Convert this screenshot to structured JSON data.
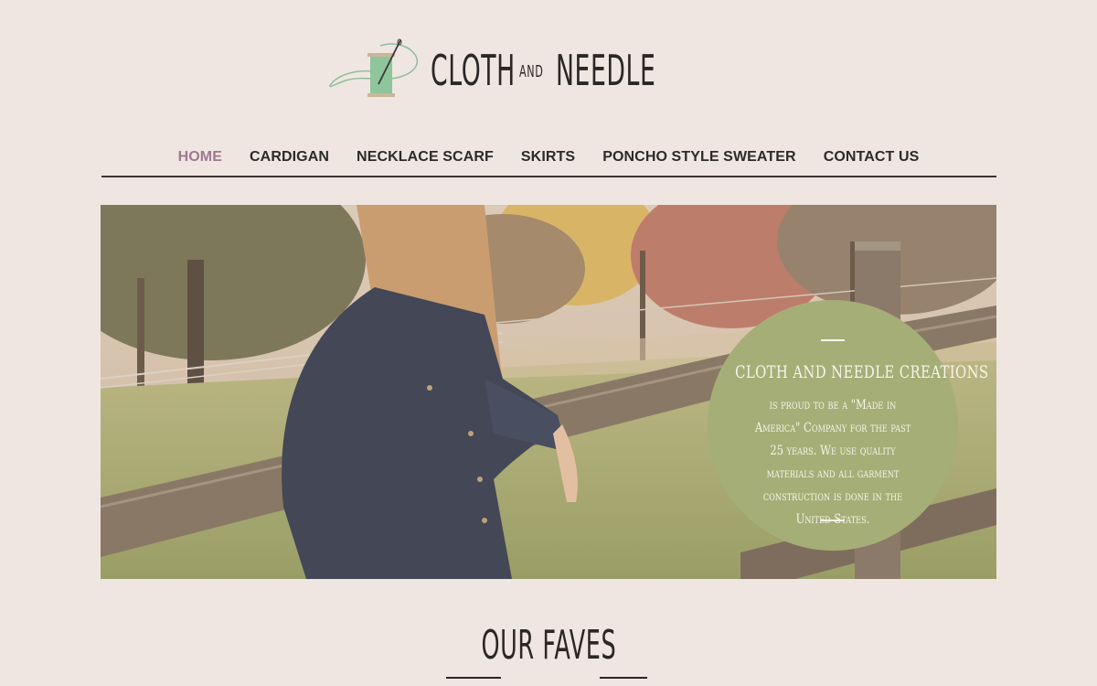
{
  "brand": {
    "word1": "CLOTH",
    "word2": "AND",
    "word3": "NEEDLE",
    "accent": "#a0788e",
    "spool_color": "#8fc59a"
  },
  "nav": {
    "items": [
      {
        "label": "HOME",
        "active": true
      },
      {
        "label": "CARDIGAN",
        "active": false
      },
      {
        "label": "NECKLACE SCARF",
        "active": false
      },
      {
        "label": "SKIRTS",
        "active": false
      },
      {
        "label": "PONCHO STYLE SWEATER",
        "active": false
      },
      {
        "label": "CONTACT US",
        "active": false
      }
    ]
  },
  "hero": {
    "title": "CLOTH AND NEEDLE CREATIONS",
    "body": "is proud to be a \"Made in America\" Company for the past 25 years.  We use quality materials and all  garment construction is done in the United States.",
    "circle_color": "#a5ae76"
  },
  "faves": {
    "title": "OUR FAVES"
  }
}
